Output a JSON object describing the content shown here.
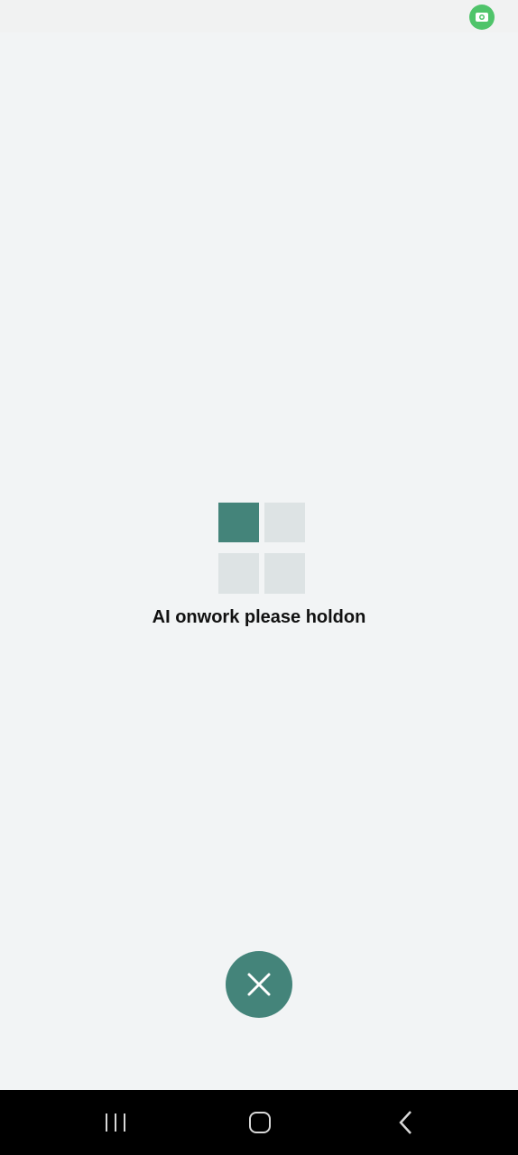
{
  "status_bar": {
    "indicator_icon": "screen-record-icon",
    "indicator_color": "#4fc46a"
  },
  "loader": {
    "icon": "grid-loading-icon",
    "active_color": "#44847a",
    "inactive_color": "#dde3e4",
    "active_tile_index": 0
  },
  "message": {
    "text": "AI onwork please holdon"
  },
  "cancel": {
    "icon": "close-icon",
    "color": "#44847a"
  },
  "navigation": {
    "recents_icon": "recents-icon",
    "home_icon": "home-icon",
    "back_icon": "back-icon"
  }
}
